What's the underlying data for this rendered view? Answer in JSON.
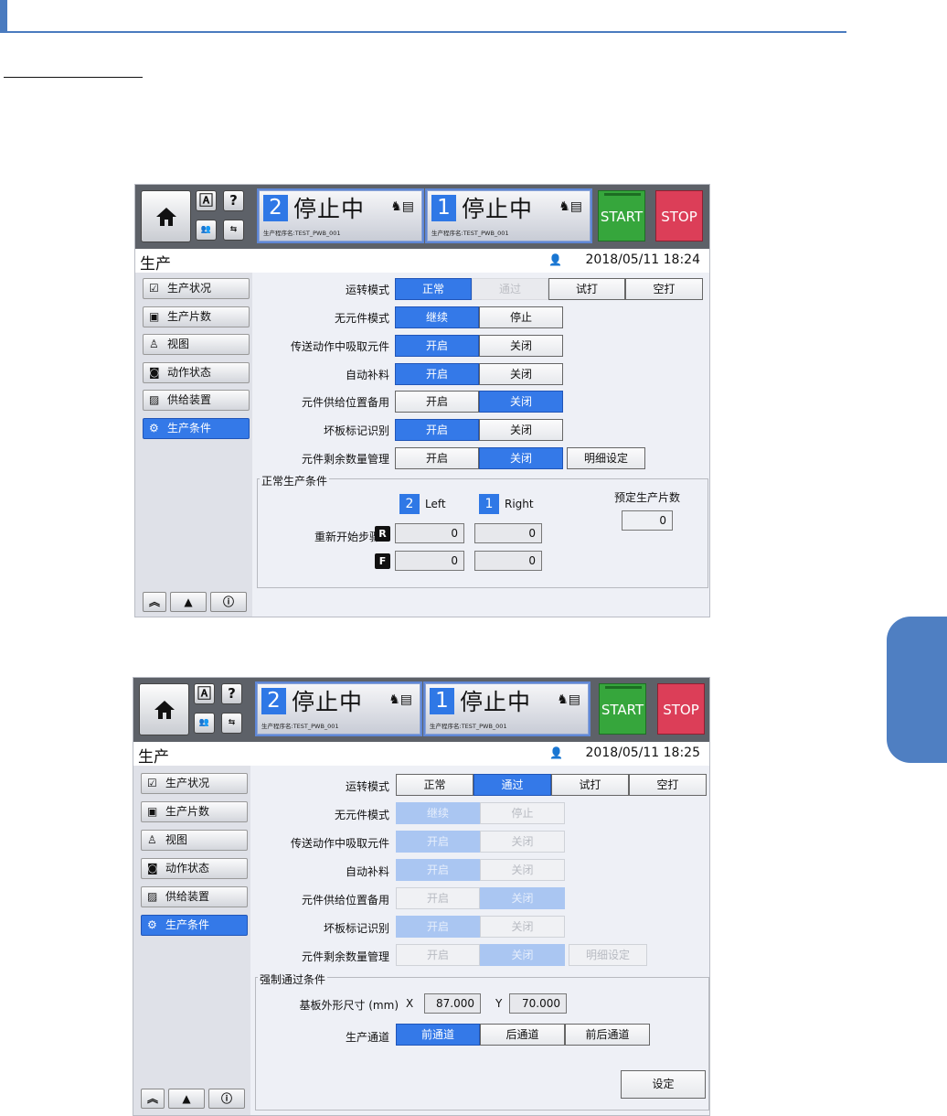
{
  "screen1": {
    "header": {
      "status_left": {
        "num": "2",
        "text": "停止中",
        "program": "生产程序名:TEST_PWB_001"
      },
      "status_right": {
        "num": "1",
        "text": "停止中",
        "program": "生产程序名:TEST_PWB_001"
      },
      "start_label": "START",
      "stop_label": "STOP"
    },
    "title": "生产",
    "datetime": "2018/05/11 18:24",
    "sidebar": [
      "生产状况",
      "生产片数",
      "视图",
      "动作状态",
      "供给装置",
      "生产条件"
    ],
    "settings": {
      "mode_label": "运转模式",
      "mode_options": [
        "正常",
        "通过",
        "试打",
        "空打"
      ],
      "no_part_label": "无元件模式",
      "no_part_options": [
        "继续",
        "停止"
      ],
      "pickup_label": "传送动作中吸取元件",
      "pickup_options": [
        "开启",
        "关闭"
      ],
      "refill_label": "自动补料",
      "refill_options": [
        "开启",
        "关闭"
      ],
      "backup_label": "元件供给位置备用",
      "backup_options": [
        "开启",
        "关闭"
      ],
      "badmark_label": "坏板标记识别",
      "badmark_options": [
        "开启",
        "关闭"
      ],
      "remain_label": "元件剩余数量管理",
      "remain_options": [
        "开启",
        "关闭"
      ],
      "detail_label": "明细设定"
    },
    "group": {
      "title": "正常生产条件",
      "left_num": "2",
      "left_label": "Left",
      "right_num": "1",
      "right_label": "Right",
      "planned_label": "预定生产片数",
      "planned_value": "0",
      "restart_label": "重新开始步骤",
      "r_label": "R",
      "f_label": "F",
      "r_left": "0",
      "r_right": "0",
      "f_left": "0",
      "f_right": "0"
    }
  },
  "screen2": {
    "header": {
      "status_left": {
        "num": "2",
        "text": "停止中",
        "program": "生产程序名:TEST_PWB_001"
      },
      "status_right": {
        "num": "1",
        "text": "停止中",
        "program": "生产程序名:TEST_PWB_001"
      },
      "start_label": "START",
      "stop_label": "STOP"
    },
    "title": "生产",
    "datetime": "2018/05/11 18:25",
    "sidebar": [
      "生产状况",
      "生产片数",
      "视图",
      "动作状态",
      "供给装置",
      "生产条件"
    ],
    "settings": {
      "mode_label": "运转模式",
      "mode_options": [
        "正常",
        "通过",
        "试打",
        "空打"
      ],
      "no_part_label": "无元件模式",
      "no_part_options": [
        "继续",
        "停止"
      ],
      "pickup_label": "传送动作中吸取元件",
      "pickup_options": [
        "开启",
        "关闭"
      ],
      "refill_label": "自动补料",
      "refill_options": [
        "开启",
        "关闭"
      ],
      "backup_label": "元件供给位置备用",
      "backup_options": [
        "开启",
        "关闭"
      ],
      "badmark_label": "坏板标记识别",
      "badmark_options": [
        "开启",
        "关闭"
      ],
      "remain_label": "元件剩余数量管理",
      "remain_options": [
        "开启",
        "关闭"
      ],
      "detail_label": "明细设定"
    },
    "group": {
      "title": "强制通过条件",
      "size_label": "基板外形尺寸 (mm)",
      "x_label": "X",
      "x_value": "87.000",
      "y_label": "Y",
      "y_value": "70.000",
      "lane_label": "生产通道",
      "lane_options": [
        "前通道",
        "后通道",
        "前后通道"
      ],
      "set_label": "设定"
    }
  }
}
